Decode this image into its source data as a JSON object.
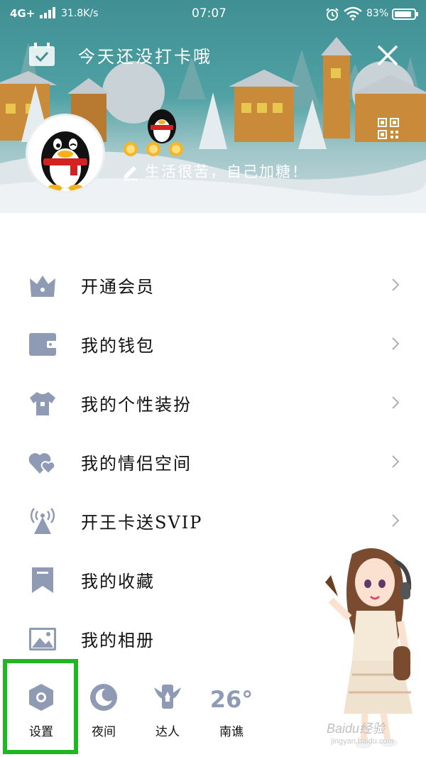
{
  "status_bar": {
    "network": "4G+",
    "speed": "31.8K/s",
    "time": "07:07",
    "battery": "83%"
  },
  "header": {
    "checkin_text": "今天还没打卡哦",
    "signature": "生活很苦，自己加糖！",
    "icons": [
      "calendar-check-icon",
      "close-icon",
      "qr-code-icon",
      "edit-icon"
    ]
  },
  "menu": {
    "items": [
      {
        "label": "开通会员",
        "icon": "crown-icon"
      },
      {
        "label": "我的钱包",
        "icon": "wallet-icon"
      },
      {
        "label": "我的个性装扮",
        "icon": "tshirt-icon"
      },
      {
        "label": "我的情侣空间",
        "icon": "hearts-icon"
      },
      {
        "label": "开王卡送SVIP",
        "icon": "signal-tower-icon"
      },
      {
        "label": "我的收藏",
        "icon": "bookmark-icon"
      },
      {
        "label": "我的相册",
        "icon": "photo-icon"
      }
    ]
  },
  "bottom_bar": {
    "settings": "设置",
    "night": "夜间",
    "expert": "达人",
    "weather_temp": "26°",
    "weather_city": "南谯"
  },
  "colors": {
    "icon_gray": "#8f9bb5",
    "highlight_green": "#22b624",
    "header_teal": "#4fa1a4"
  },
  "watermark": {
    "text": "Baidu经验",
    "sub": "jingyan.baidu.com"
  }
}
